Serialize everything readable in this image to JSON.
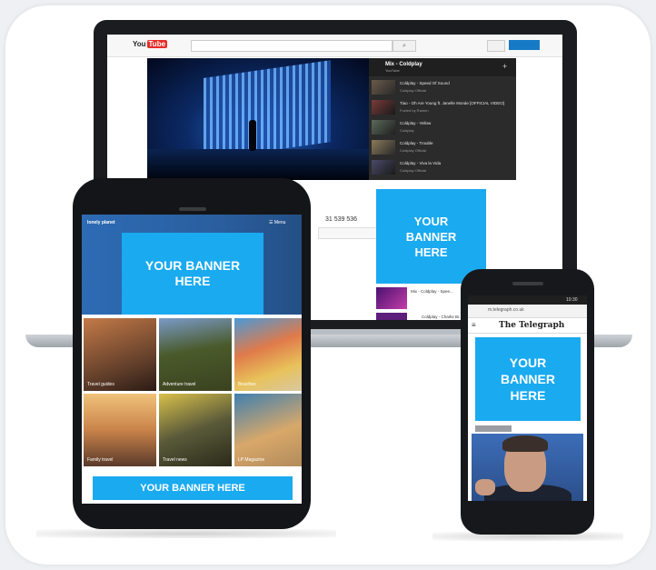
{
  "laptop": {
    "site_logo": "You",
    "site_logo_badge": "Tube",
    "views": "31 539 536",
    "playlist_title": "Mix - Coldplay",
    "playlist_sub": "YouTube",
    "playlist": [
      {
        "title": "Coldplay - Speed Of Sound",
        "meta": "Coldplay Official"
      },
      {
        "title": "Tiao - Oh Are Young ft. Janelle Monáe [OFFICIAL VIDEO]",
        "meta": "Fueled by Ramen"
      },
      {
        "title": "Coldplay - Yellow",
        "meta": "Coldplay"
      },
      {
        "title": "Coldplay - Trouble",
        "meta": "Coldplay Official"
      },
      {
        "title": "Coldplay - Viva la Vida",
        "meta": "Coldplay Official"
      }
    ],
    "related": [
      {
        "title": "Mix - Coldplay - Spee..."
      },
      {
        "title": "Coldplay - Charlie Br..."
      }
    ],
    "side_banner": "YOUR\nBANNER\nHERE"
  },
  "tablet": {
    "logo": "lonely planet",
    "menu": "☰ Menu",
    "top_banner": "YOUR BANNER\nHERE",
    "tiles": [
      {
        "label": "Travel guides",
        "color": "#8b5a3c"
      },
      {
        "label": "Adventure travel",
        "color": "#5d6b3a"
      },
      {
        "label": "Beaches",
        "color": "#d96b4a"
      },
      {
        "label": "Family travel",
        "color": "#c98b3c"
      },
      {
        "label": "Travel news",
        "color": "#7a6b2a"
      },
      {
        "label": "LP Magazine",
        "color": "#3f7fb0"
      }
    ],
    "bottom_banner": "YOUR BANNER HERE"
  },
  "phone": {
    "time": "10:30",
    "url": "m.telegraph.co.uk",
    "masthead": "The Telegraph",
    "banner": "YOUR\nBANNER\nHERE"
  },
  "colors": {
    "banner_blue": "#1aaaf0"
  }
}
